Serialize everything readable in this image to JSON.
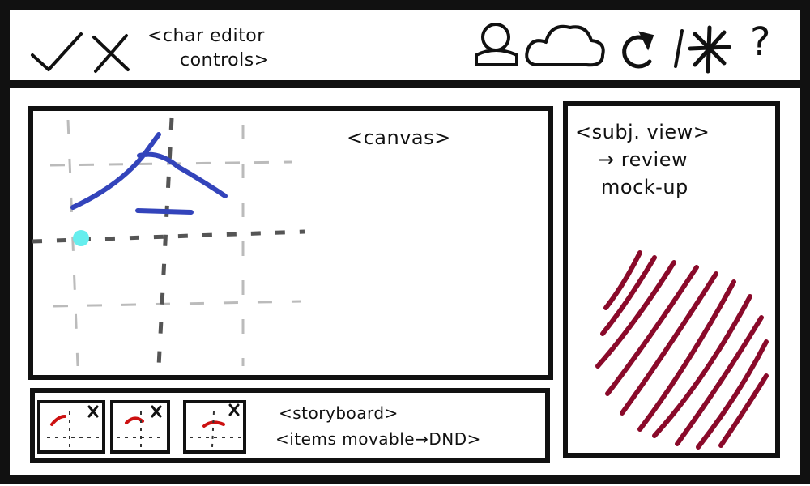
{
  "toolbar": {
    "confirm_icon": "check-icon",
    "cancel_icon": "close-icon",
    "editor_controls_label_line1": "<char editor",
    "editor_controls_label_line2": "controls>",
    "right_icons": [
      "user-icon",
      "cloud-icon",
      "refresh-icon",
      "settings-icon",
      "help-icon"
    ],
    "help_glyph": "?"
  },
  "canvas": {
    "label": "<canvas>"
  },
  "subject_view": {
    "label_line1": "<subj. view>",
    "label_line2": "→ review",
    "label_line3": "mock-up"
  },
  "storyboard": {
    "label_line1": "<storyboard>",
    "label_line2": "<items movable→DND>",
    "items": [
      {
        "close_glyph": "x"
      },
      {
        "close_glyph": "x"
      },
      {
        "close_glyph": "x"
      }
    ]
  },
  "colors": {
    "ink": "#111111",
    "stroke_blue": "#3344bb",
    "cursor_cyan": "#66eeee",
    "preview_maroon": "#8a0a2a",
    "frame_red": "#cc1111"
  }
}
